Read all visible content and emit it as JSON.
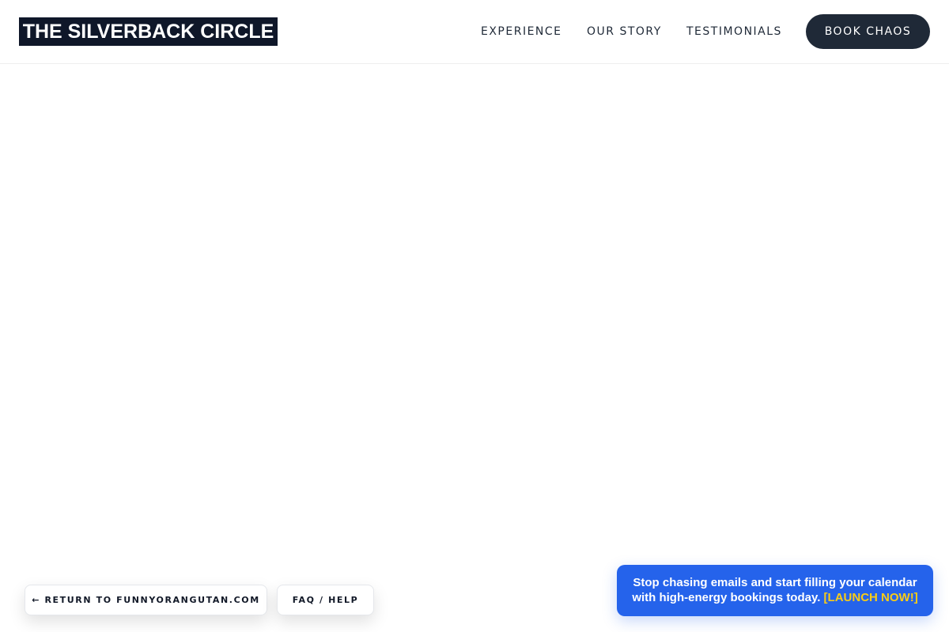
{
  "header": {
    "logo_text": "THE SILVERBACK CIRCLE",
    "nav": {
      "experience": "EXPERIENCE",
      "our_story": "OUR STORY",
      "testimonials": "TESTIMONIALS"
    },
    "book_button": "BOOK CHAOS"
  },
  "footer": {
    "return_button": "← RETURN TO FUNNYORANGUTAN.COM",
    "faq_button": "FAQ / HELP"
  },
  "banner": {
    "line1": "Stop chasing emails and start filling your calendar",
    "line2": "with high-energy bookings today.",
    "cta": "[LAUNCH NOW!]"
  },
  "colors": {
    "logo_bg": "#0f1729",
    "book_button_bg": "#1f2937",
    "banner_bg": "#2563eb",
    "cta_text": "#facc15"
  }
}
